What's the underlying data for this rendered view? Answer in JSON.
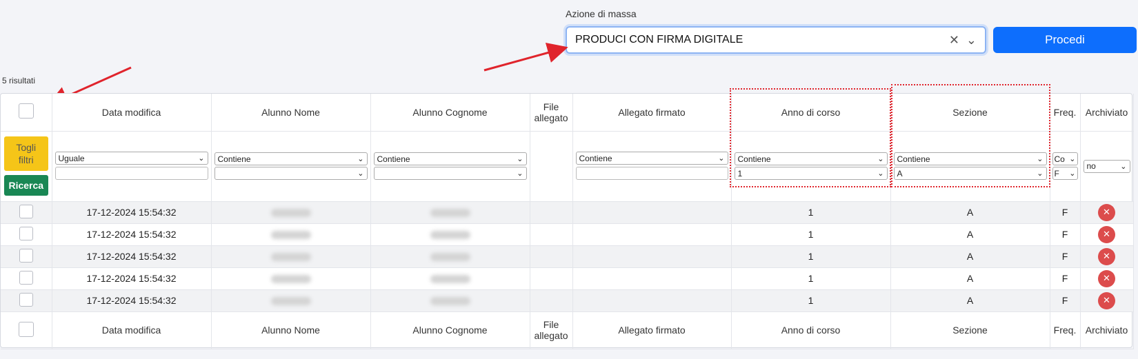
{
  "mass_action": {
    "label": "Azione di massa",
    "selected": "PRODUCI CON FIRMA DIGITALE",
    "procedi_label": "Procedi"
  },
  "results_count": "5 risultati",
  "columns": [
    "Data modifica",
    "Alunno Nome",
    "Alunno Cognome",
    "File allegato",
    "Allegato firmato",
    "Anno di corso",
    "Sezione",
    "Freq.",
    "Archiviato"
  ],
  "filters": {
    "togli_label": "Togli filtri",
    "ricerca_label": "Ricerca",
    "data_modifica_op": "Uguale",
    "alunno_nome_op": "Contiene",
    "alunno_cognome_op": "Contiene",
    "allegato_firmato_op": "Contiene",
    "anno_op": "Contiene",
    "anno_value": "1",
    "sezione_op": "Contiene",
    "sezione_value": "A",
    "freq_op": "Co",
    "freq_value": "F",
    "archiviato_value": "no"
  },
  "rows": [
    {
      "data_modifica": "17-12-2024 15:54:32",
      "anno": "1",
      "sezione": "A",
      "freq": "F"
    },
    {
      "data_modifica": "17-12-2024 15:54:32",
      "anno": "1",
      "sezione": "A",
      "freq": "F"
    },
    {
      "data_modifica": "17-12-2024 15:54:32",
      "anno": "1",
      "sezione": "A",
      "freq": "F"
    },
    {
      "data_modifica": "17-12-2024 15:54:32",
      "anno": "1",
      "sezione": "A",
      "freq": "F"
    },
    {
      "data_modifica": "17-12-2024 15:54:32",
      "anno": "1",
      "sezione": "A",
      "freq": "F"
    }
  ],
  "icons": {
    "clear": "clear-x-icon",
    "dropdown": "chevron-down-icon",
    "delete": "delete-circle-icon"
  },
  "colors": {
    "primary": "#0d6efd",
    "warning": "#f5c518",
    "success": "#198754",
    "danger": "#dc4c4c",
    "annotation": "#e0242c"
  }
}
